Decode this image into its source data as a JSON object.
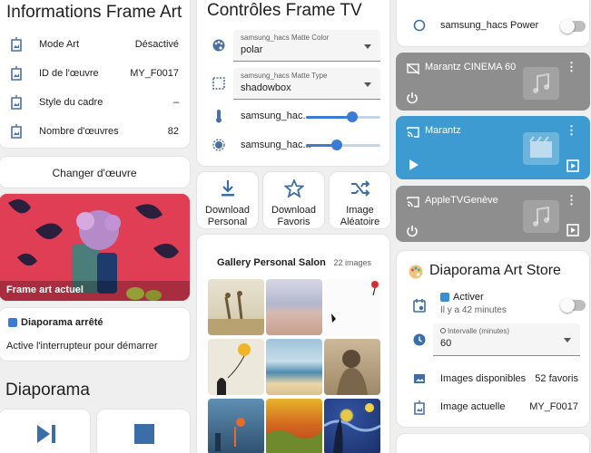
{
  "frame_info": {
    "title": "Informations Frame Art",
    "rows": [
      {
        "label": "Mode Art",
        "value": "Désactivé"
      },
      {
        "label": "ID de l'œuvre",
        "value": "MY_F0017"
      },
      {
        "label": "Style du cadre",
        "value": "–"
      },
      {
        "label": "Nombre d'œuvres",
        "value": "82"
      }
    ]
  },
  "change_button": {
    "label": "Changer d'œuvre"
  },
  "frame_image": {
    "caption": "Frame art actuel"
  },
  "slideshow_status": {
    "title": "Diaporama arrêté",
    "text": "Active l'interrupteur pour démarrer"
  },
  "diaporama": {
    "title": "Diaporama"
  },
  "controls": {
    "title": "Contrôles Frame TV",
    "matte_color": {
      "label": "samsung_hacs Matte Color",
      "value": "polar"
    },
    "matte_type": {
      "label": "samsung_hacs Matte Type",
      "value": "shadowbox"
    },
    "slider1": {
      "label": "samsung_hac...",
      "value": 0.62
    },
    "slider2": {
      "label": "samsung_hac...",
      "value": 0.42
    }
  },
  "tiles": [
    {
      "line1": "Download",
      "line2": "Personal"
    },
    {
      "line1": "Download",
      "line2": "Favoris"
    },
    {
      "line1": "Image",
      "line2": "Aléatoire"
    }
  ],
  "gallery": {
    "title": "Gallery Personal Salon",
    "count": "22 images"
  },
  "power": {
    "label": "samsung_hacs Power"
  },
  "media": [
    {
      "name": "Marantz CINEMA 60",
      "color": "#8e8e8e"
    },
    {
      "name": "Marantz",
      "color": "#3d9bd1"
    },
    {
      "name": "AppleTVGenève",
      "color": "#8e8e8e"
    }
  ],
  "art_store": {
    "title": "Diaporama Art Store",
    "activate_label": "Activer",
    "activate_time": "Il y a 42 minutes",
    "interval_label": "Intervalle (minutes)",
    "interval_value": "60",
    "available_label": "Images disponibles",
    "available_value": "52 favoris",
    "current_label": "Image actuelle",
    "current_value": "MY_F0017"
  }
}
